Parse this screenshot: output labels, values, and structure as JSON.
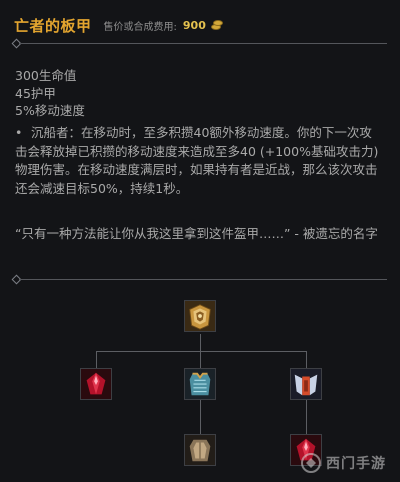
{
  "item": {
    "name": "亡者的板甲",
    "cost_label": "售价或合成费用:",
    "cost_value": "900",
    "cost_icon": "gold-coin-icon"
  },
  "stats": [
    "300生命值",
    "45护甲",
    "5%移动速度"
  ],
  "passive": {
    "bullet": "•",
    "text": "沉船者：在移动时，至多积攒40额外移动速度。你的下一次攻击会释放掉已积攒的移动速度来造成至多40 (+100%基础攻击力)物理伤害。在移动速度满层时，如果持有者是近战，那么该次攻击还会减速目标50%，持续1秒。"
  },
  "quote": "“只有一种方法能让你从我这里拿到这件盔甲……” - 被遗忘的名字",
  "recipe_tree": {
    "root": "dead-mans-plate-icon",
    "components": [
      "ruby-crystal-icon",
      "chain-vest-icon",
      "winged-boots-icon"
    ],
    "sub_components": [
      "cloth-armor-icon",
      "ruby-crystal-icon"
    ]
  },
  "watermark": {
    "text": "西门手游"
  },
  "colors": {
    "title": "#e3a52f",
    "background": "#131417",
    "body_text": "#a9a9a9",
    "divider": "#54565b"
  }
}
